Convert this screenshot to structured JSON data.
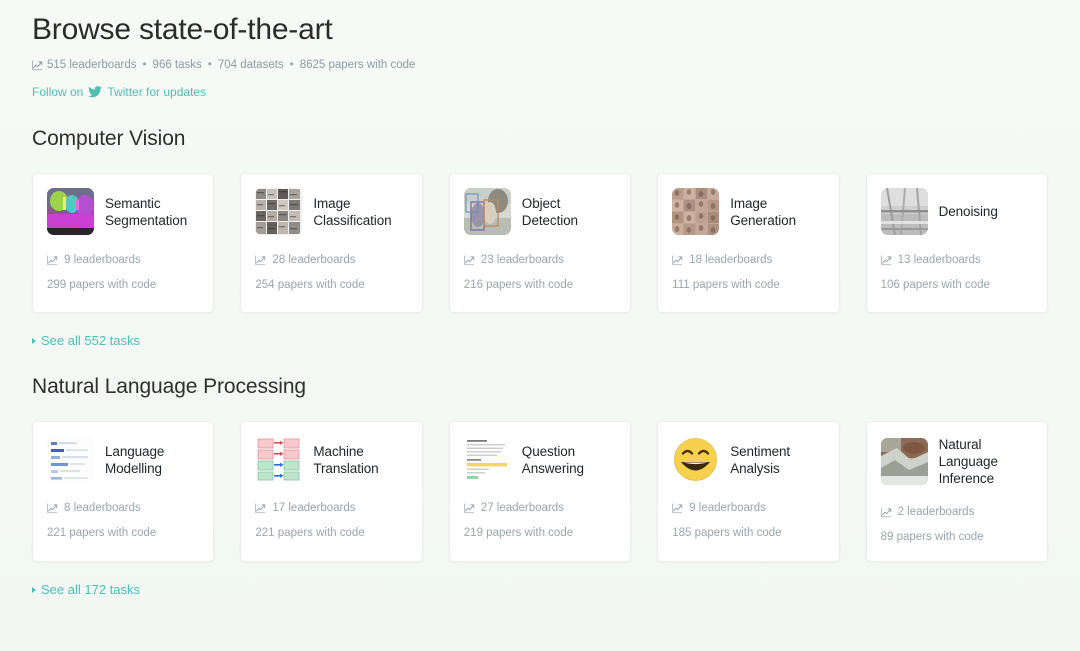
{
  "header": {
    "title": "Browse state-of-the-art",
    "stats": {
      "leaderboards": "515 leaderboards",
      "tasks": "966 tasks",
      "datasets": "704 datasets",
      "papers": "8625 papers with code",
      "separator": "•",
      "icon": "chart-line-up-icon"
    },
    "follow": {
      "prefix": "Follow on",
      "icon": "twitter-bird-icon",
      "suffix": "Twitter for updates"
    }
  },
  "colors": {
    "accent": "#4ec0b1",
    "page_bg": "#f4f8f5",
    "card_bg": "#ffffff",
    "title": "#2b2b2b",
    "muted": "#9aa5ad"
  },
  "sections": [
    {
      "title": "Computer Vision",
      "see_all": "See all 552 tasks",
      "cards": [
        {
          "title": "Semantic Segmentation",
          "leaderboards": "9 leaderboards",
          "papers": "299 papers with code",
          "thumb": "semantic-segmentation-thumbnail"
        },
        {
          "title": "Image Classification",
          "leaderboards": "28 leaderboards",
          "papers": "254 papers with code",
          "thumb": "image-classification-thumbnail"
        },
        {
          "title": "Object Detection",
          "leaderboards": "23 leaderboards",
          "papers": "216 papers with code",
          "thumb": "object-detection-thumbnail"
        },
        {
          "title": "Image Generation",
          "leaderboards": "18 leaderboards",
          "papers": "111 papers with code",
          "thumb": "image-generation-thumbnail"
        },
        {
          "title": "Denoising",
          "leaderboards": "13 leaderboards",
          "papers": "106 papers with code",
          "thumb": "denoising-thumbnail"
        }
      ]
    },
    {
      "title": "Natural Language Processing",
      "see_all": "See all 172 tasks",
      "cards": [
        {
          "title": "Language Modelling",
          "leaderboards": "8 leaderboards",
          "papers": "221 papers with code",
          "thumb": "language-modelling-thumbnail"
        },
        {
          "title": "Machine Translation",
          "leaderboards": "17 leaderboards",
          "papers": "221 papers with code",
          "thumb": "machine-translation-thumbnail"
        },
        {
          "title": "Question Answering",
          "leaderboards": "27 leaderboards",
          "papers": "219 papers with code",
          "thumb": "question-answering-thumbnail"
        },
        {
          "title": "Sentiment Analysis",
          "leaderboards": "9 leaderboards",
          "papers": "185 papers with code",
          "thumb": "sentiment-analysis-thumbnail"
        },
        {
          "title": "Natural Language Inference",
          "leaderboards": "2 leaderboards",
          "papers": "89 papers with code",
          "thumb": "natural-language-inference-thumbnail"
        }
      ]
    }
  ]
}
